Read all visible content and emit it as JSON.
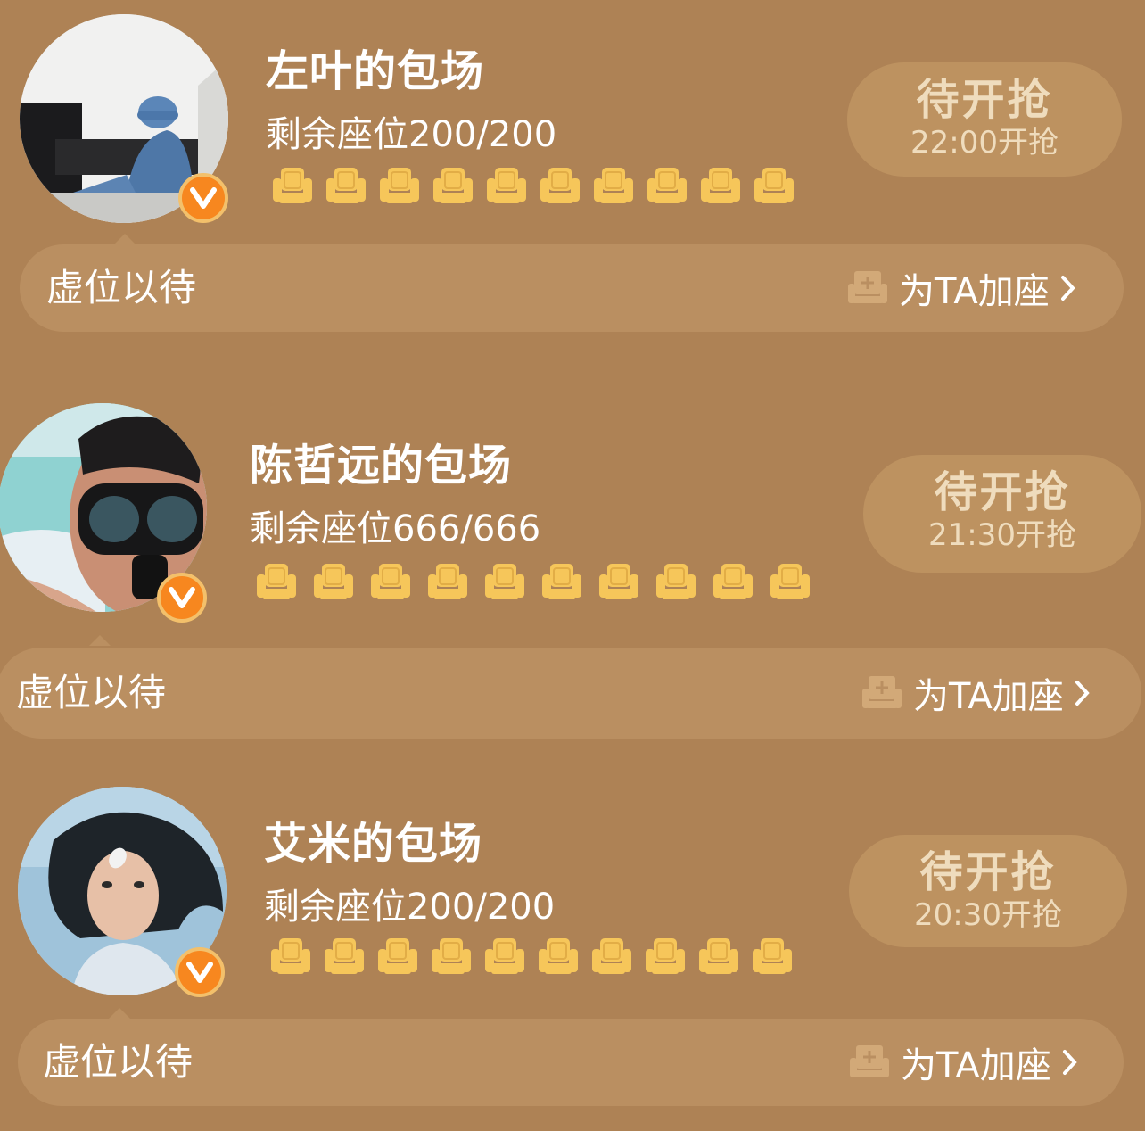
{
  "cards": [
    {
      "title": "左叶的包场",
      "seats_text": "剩余座位200/200",
      "grab_label": "待开抢",
      "grab_time": "22:00开抢",
      "bar_label": "虚位以待",
      "bar_action": "为TA加座",
      "seat_icon_count": 10
    },
    {
      "title": "陈哲远的包场",
      "seats_text": "剩余座位666/666",
      "grab_label": "待开抢",
      "grab_time": "21:30开抢",
      "bar_label": "虚位以待",
      "bar_action": "为TA加座",
      "seat_icon_count": 10
    },
    {
      "title": "艾米的包场",
      "seats_text": "剩余座位200/200",
      "grab_label": "待开抢",
      "grab_time": "20:30开抢",
      "bar_label": "虚位以待",
      "bar_action": "为TA加座",
      "seat_icon_count": 10
    }
  ],
  "icons": {
    "badge": "verified-v-icon",
    "seat": "armchair-icon",
    "add_seat": "add-seat-icon",
    "chevron": "chevron-right-icon"
  },
  "colors": {
    "background": "#ae8255",
    "bar": "#ba8f61",
    "button": "#bd9260",
    "button_text": "#efdcbd",
    "seat": "#f6c65a",
    "badge": "#f7871f"
  }
}
